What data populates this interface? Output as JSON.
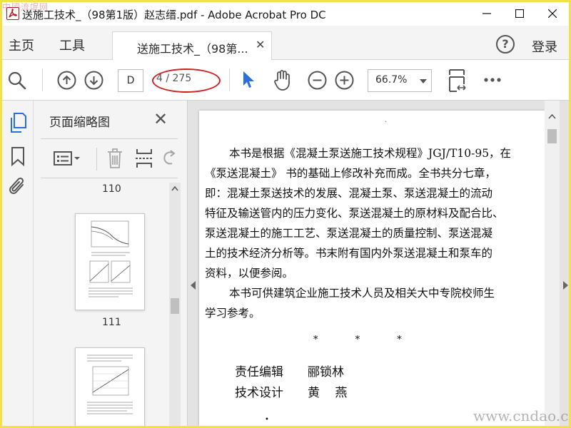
{
  "window": {
    "title": "送施工技术_（98第1版）赵志缙.pdf - Adobe Acrobat Pro DC",
    "watermark_top": "中國流氓网"
  },
  "tabs": {
    "home": "主页",
    "tools": "工具",
    "document_tab": "送施工技术_（98第...",
    "login": "登录",
    "help": "?"
  },
  "toolbar": {
    "page_input": "D",
    "page_count": "4 / 275",
    "zoom": "66.7%"
  },
  "thumbnails": {
    "panel_title": "页面缩略图",
    "pages": [
      {
        "label": "110"
      },
      {
        "label": "111"
      }
    ]
  },
  "document": {
    "lines": [
      "本书是根据《混凝土泵送施工技术规程》JGJ/T10-95，在",
      "《泵送混凝土》 书的基础上修改补充而成。全书共分七章，",
      "即：混凝土泵送技术的发展、混凝土泵、泵送混凝土的流动",
      "特征及输送管内的压力变化、泵送混凝土的原材料及配合比、",
      "泵送混凝土的施工工艺、泵送混凝土的质量控制、泵送混凝",
      "土的技术经济分析等。书末附有国内外泵送混凝土和泵车的",
      "资料，以便参阅。",
      "本书可供建筑企业施工技术人员及相关大中专院校师生",
      "学习参考。"
    ],
    "stars": "*   *   *",
    "credits": [
      {
        "role": "责任编辑",
        "name": "郦锁林"
      },
      {
        "role": "技术设计",
        "name": "黄 燕"
      }
    ]
  },
  "watermark_site": "www.cndao.com"
}
